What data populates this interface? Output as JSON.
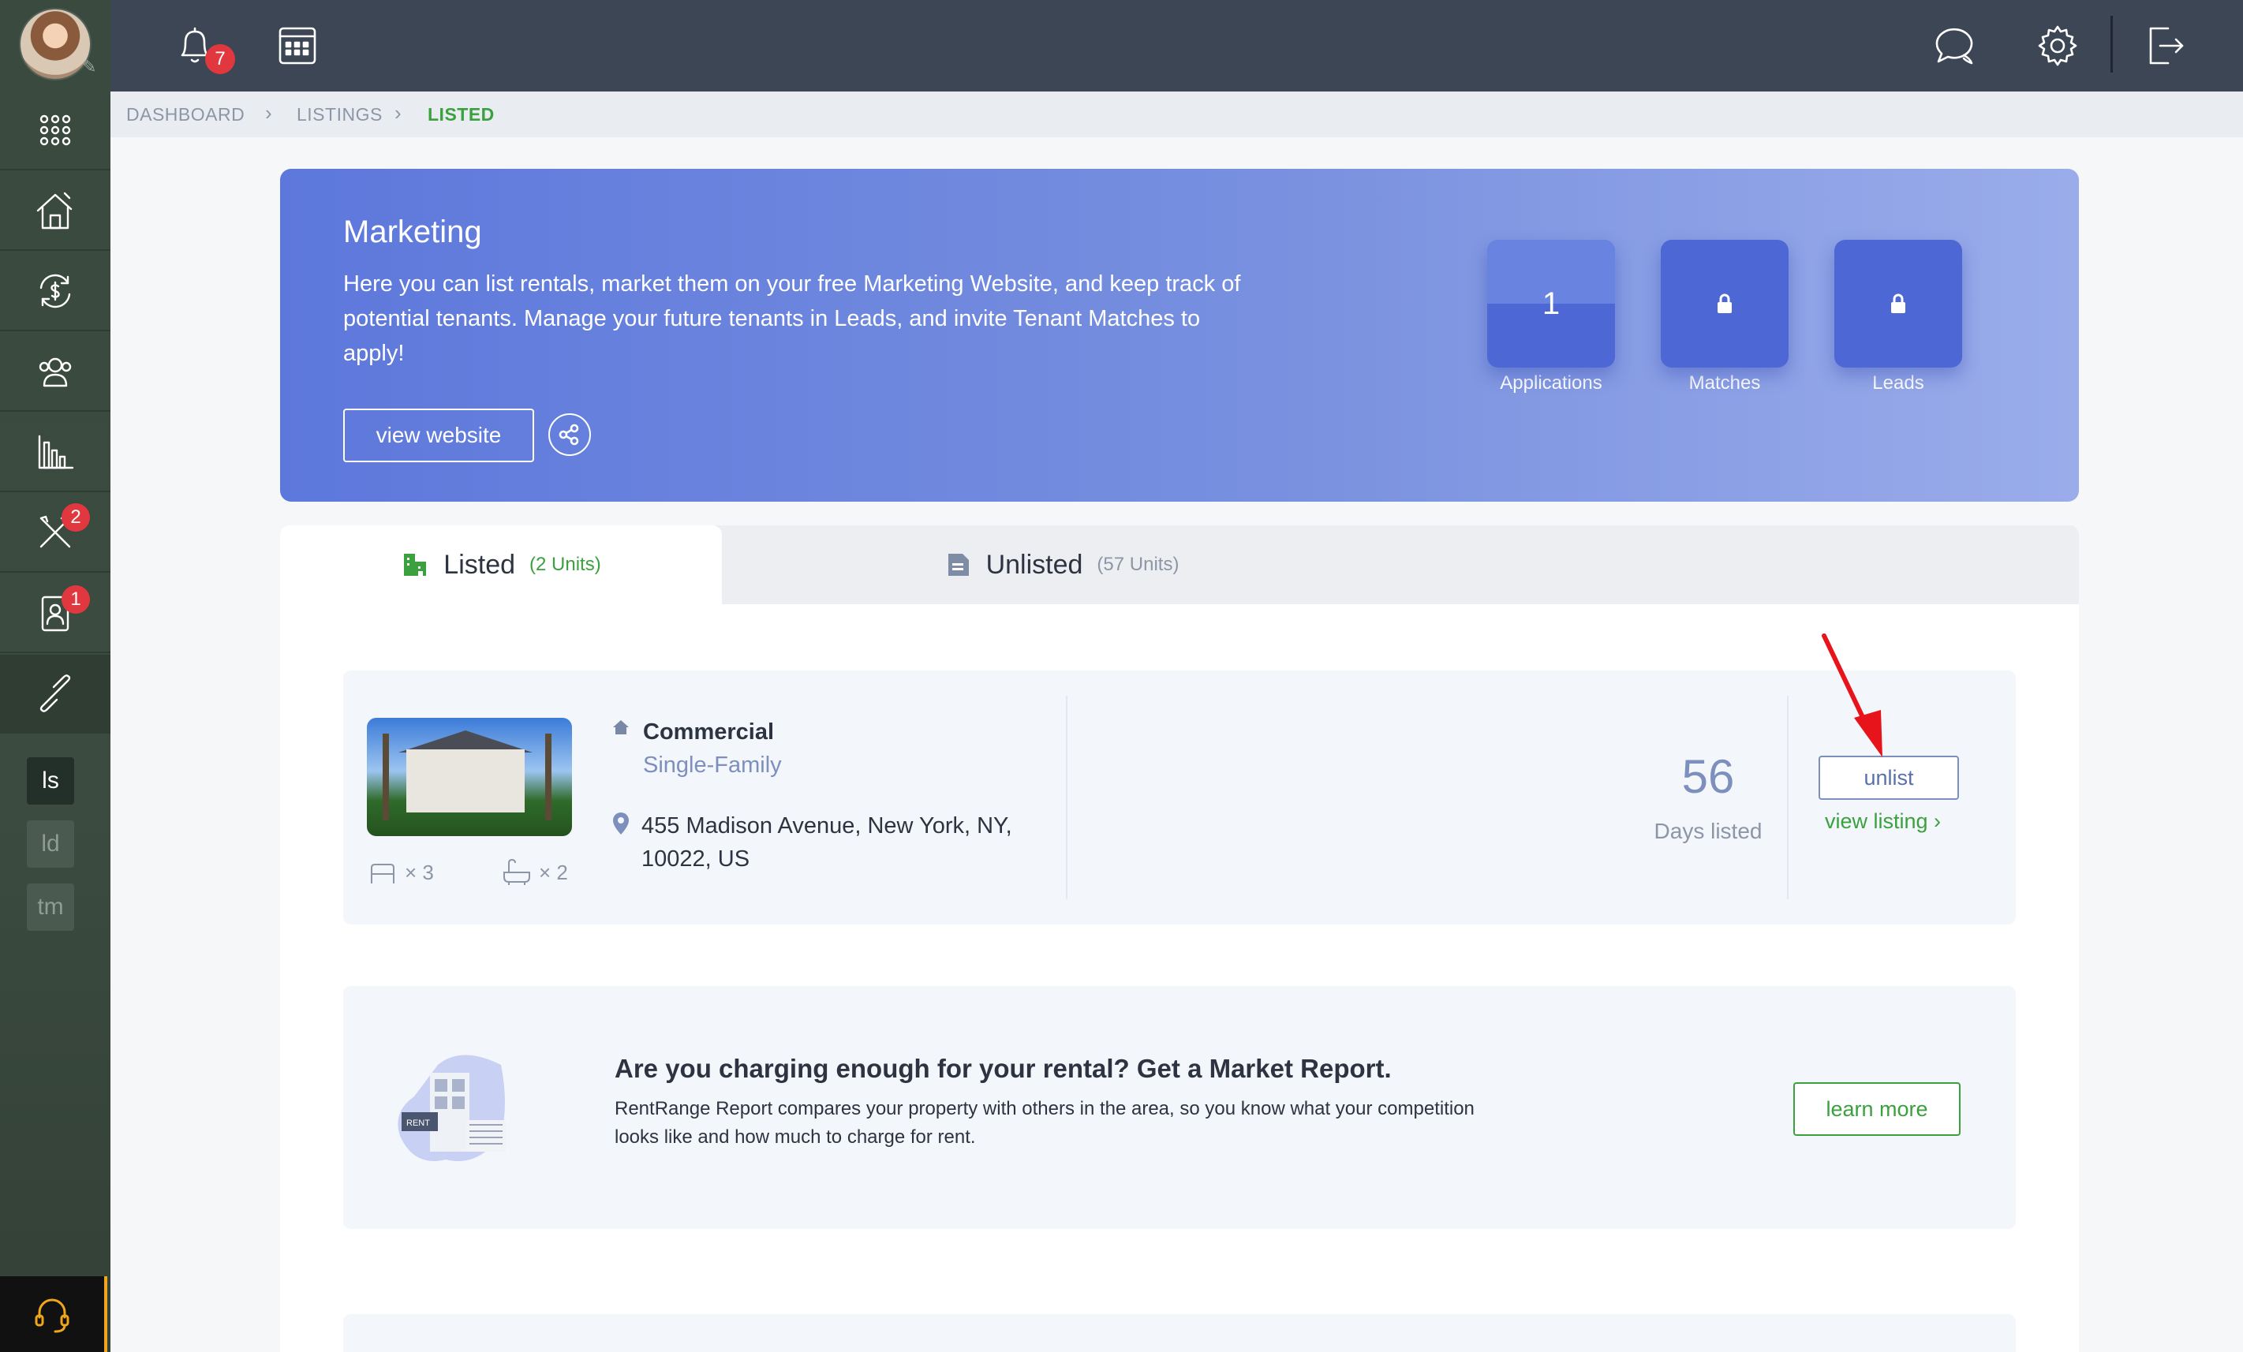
{
  "topbar": {
    "notifications_count": "7"
  },
  "sidebar": {
    "maintenance_badge": "2",
    "tenants_badge": "1",
    "sub_items": [
      "ls",
      "ld",
      "tm"
    ]
  },
  "breadcrumb": [
    "DASHBOARD",
    "LISTINGS",
    "LISTED"
  ],
  "hero": {
    "title": "Marketing",
    "description": "Here you can list rentals, market them on your free Marketing Website, and keep track of potential tenants. Manage your future tenants in Leads, and invite Tenant Matches to apply!",
    "button": "view website",
    "stats": [
      {
        "label": "Applications",
        "value": "1"
      },
      {
        "label": "Matches",
        "value": ""
      },
      {
        "label": "Leads",
        "value": ""
      }
    ]
  },
  "tabs": [
    {
      "label": "Listed",
      "count": "(2 Units)"
    },
    {
      "label": "Unlisted",
      "count": "(57 Units)"
    }
  ],
  "listing": {
    "type": "Commercial",
    "subtype": "Single-Family",
    "address": "455 Madison Avenue, New York, NY, 10022, US",
    "beds": "× 3",
    "baths": "× 2",
    "days": "56",
    "days_label": "Days listed",
    "unlist": "unlist",
    "view": "view listing ›"
  },
  "report": {
    "title": "Are you charging enough for your rental? Get a Market Report.",
    "description": "RentRange Report compares your property with others in the area, so you know what your competition looks like and how much to charge for rent.",
    "button": "learn more",
    "sign_text": "RENT"
  },
  "colors": {
    "accent_green": "#3aa13e",
    "hero_blue": "#5d78dc",
    "badge_red": "#e0383e",
    "arrow_red": "#e8141c"
  }
}
